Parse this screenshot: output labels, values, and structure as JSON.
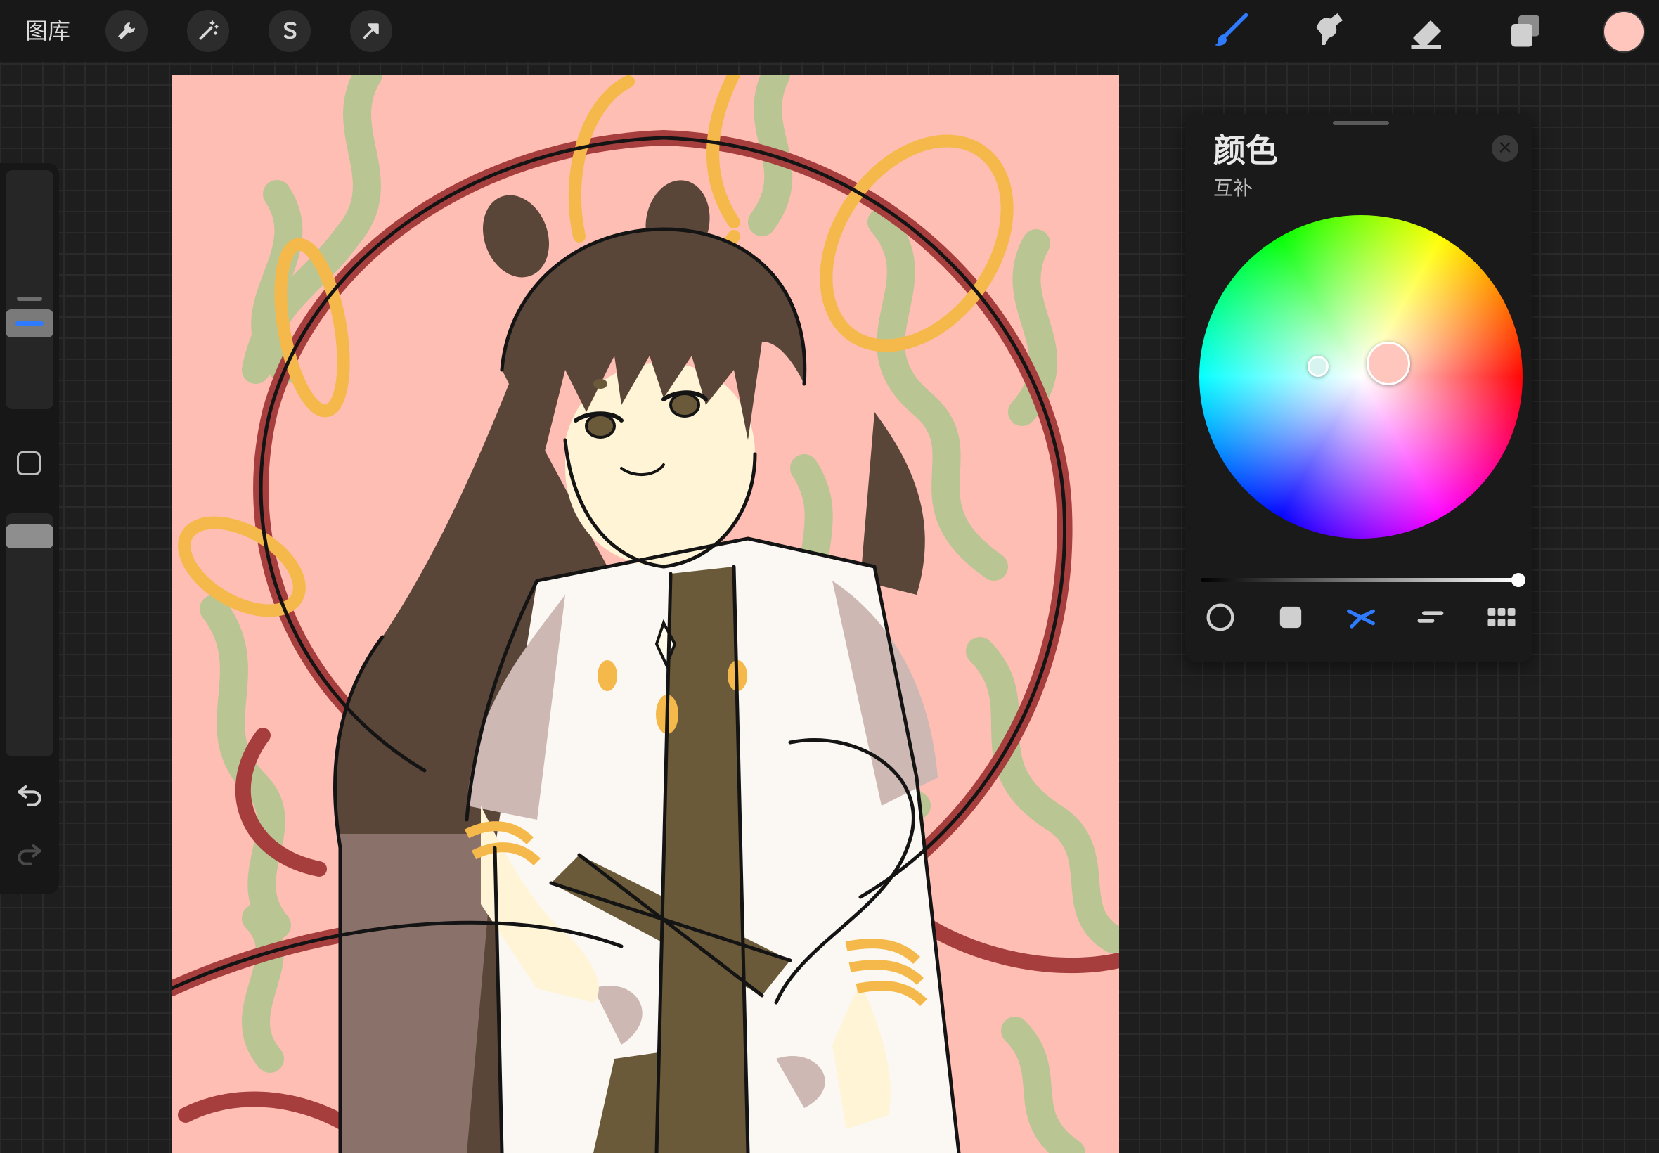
{
  "toolbar": {
    "gallery_label": "图库",
    "left_tools": [
      {
        "name": "actions",
        "icon": "wrench-icon"
      },
      {
        "name": "adjustments",
        "icon": "magic-wand-icon"
      },
      {
        "name": "selection",
        "icon": "selection-s-icon"
      },
      {
        "name": "transform",
        "icon": "arrow-cursor-icon"
      }
    ],
    "right_tools": [
      {
        "name": "brush",
        "icon": "brush-icon",
        "active": true
      },
      {
        "name": "smudge",
        "icon": "smudge-icon",
        "active": false
      },
      {
        "name": "eraser",
        "icon": "eraser-icon",
        "active": false
      },
      {
        "name": "layers",
        "icon": "layers-icon",
        "active": false
      }
    ],
    "current_color": "#ffc6be"
  },
  "sidebar": {
    "brush_size": 0.62,
    "opacity": 1.0,
    "undo_icon": "undo-icon",
    "redo_icon": "redo-icon"
  },
  "color_panel": {
    "title": "颜色",
    "mode": "互补",
    "close_icon": "close-icon",
    "brightness": 1.0,
    "primary_color": "#ffc6be",
    "complementary_color": "#d7f4f0",
    "mode_icons": [
      "disc-icon",
      "classic-icon",
      "harmony-icon",
      "value-icon",
      "palettes-icon"
    ],
    "active_mode": "harmony-icon"
  },
  "canvas": {
    "palette": {
      "background": "#ffbeb4",
      "green": "#b9c592",
      "red": "#a73e3e",
      "gold": "#f4b94a",
      "hair": "#5a4639",
      "skin": "#fff4d6",
      "robe": "#fbf7f3",
      "robe_shadow": "#cdb8b4",
      "sash": "#6b5a3a",
      "line": "#141414"
    }
  }
}
